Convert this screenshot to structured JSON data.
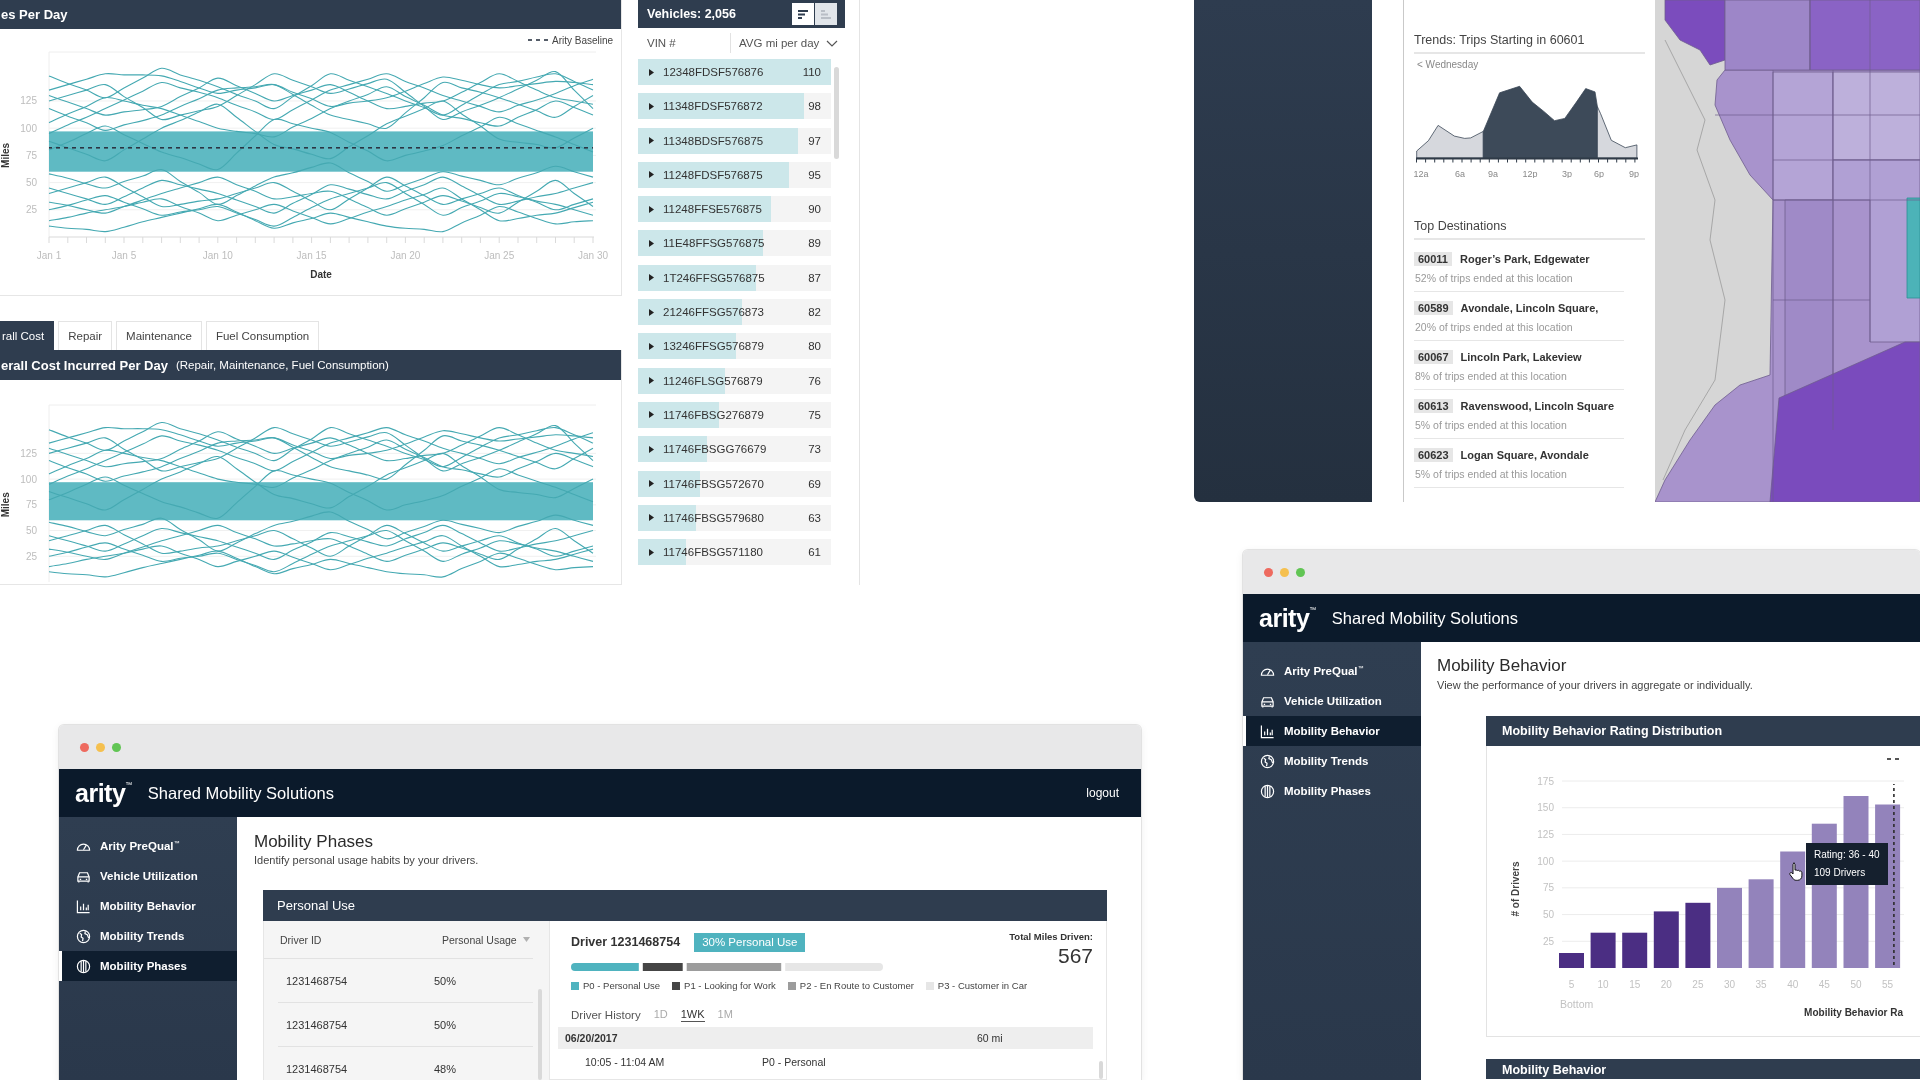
{
  "daily_miles": {
    "title": "es Per Day",
    "chart_data": {
      "type": "line",
      "xlabel": "Date",
      "ylabel": "Miles",
      "categories": [
        "Jan 1",
        null,
        null,
        null,
        "Jan 5",
        null,
        null,
        null,
        null,
        "Jan 10",
        null,
        null,
        null,
        null,
        "Jan 15",
        null,
        null,
        null,
        null,
        "Jan 20",
        null,
        null,
        null,
        null,
        "Jan 25",
        null,
        null,
        null,
        null,
        "Jan 30"
      ],
      "series": [
        {
          "color": "#45a9b2",
          "values": [
            135,
            140,
            145,
            150,
            149,
            149,
            148,
            143,
            137,
            132,
            135,
            137,
            140,
            133,
            127,
            120,
            123,
            125,
            128,
            134,
            141,
            147,
            144,
            140,
            137,
            139,
            141,
            143,
            142,
            140
          ]
        },
        {
          "color": "#45a9b2",
          "values": [
            130,
            124,
            118,
            112,
            115,
            117,
            120,
            129,
            137,
            146,
            139,
            132,
            125,
            130,
            135,
            140,
            133,
            125,
            118,
            120,
            123,
            125,
            133,
            142,
            150,
            143,
            135,
            128,
            125,
            122
          ]
        },
        {
          "color": "#45a9b2",
          "values": [
            125,
            130,
            135,
            140,
            129,
            119,
            108,
            112,
            116,
            120,
            130,
            140,
            150,
            144,
            138,
            132,
            136,
            141,
            145,
            133,
            120,
            108,
            115,
            121,
            128,
            136,
            144,
            152,
            135,
            118
          ]
        },
        {
          "color": "#45a9b2",
          "values": [
            95,
            103,
            110,
            118,
            126,
            134,
            142,
            137,
            133,
            128,
            121,
            115,
            108,
            117,
            126,
            135,
            140,
            145,
            150,
            143,
            137,
            130,
            125,
            120,
            115,
            121,
            126,
            132,
            139,
            145
          ]
        },
        {
          "color": "#45a9b2",
          "values": [
            118,
            111,
            105,
            98,
            103,
            107,
            112,
            120,
            127,
            135,
            137,
            138,
            140,
            131,
            121,
            112,
            108,
            104,
            100,
            114,
            128,
            142,
            137,
            133,
            128,
            122,
            116,
            110,
            120,
            130
          ]
        },
        {
          "color": "#45a9b2",
          "values": [
            105,
            113,
            120,
            128,
            125,
            121,
            118,
            112,
            106,
            100,
            97,
            95,
            92,
            101,
            109,
            118,
            125,
            131,
            138,
            129,
            121,
            112,
            109,
            105,
            102,
            110,
            117,
            125,
            119,
            112
          ]
        },
        {
          "color": "#45a9b2",
          "values": [
            88,
            82,
            76,
            70,
            80,
            90,
            100,
            107,
            115,
            122,
            110,
            97,
            85,
            81,
            76,
            72,
            83,
            93,
            104,
            111,
            118,
            125,
            113,
            102,
            90,
            87,
            85,
            82,
            91,
            100
          ]
        },
        {
          "color": "#45a9b2",
          "values": [
            80,
            87,
            95,
            102,
            94,
            86,
            78,
            73,
            67,
            62,
            77,
            93,
            108,
            104,
            100,
            96,
            87,
            79,
            70,
            75,
            79,
            84,
            93,
            101,
            110,
            104,
            98,
            92,
            85,
            78
          ]
        },
        {
          "color": "#45a9b2",
          "values": [
            45,
            40,
            35,
            30,
            37,
            45,
            52,
            48,
            44,
            40,
            34,
            28,
            22,
            31,
            39,
            48,
            44,
            39,
            35,
            42,
            48,
            55,
            47,
            38,
            30,
            33,
            37,
            40,
            45,
            50
          ]
        },
        {
          "color": "#45a9b2",
          "values": [
            40,
            45,
            50,
            55,
            46,
            37,
            28,
            30,
            33,
            35,
            40,
            45,
            50,
            42,
            33,
            25,
            35,
            45,
            55,
            47,
            38,
            30,
            35,
            40,
            45,
            38,
            32,
            25,
            30,
            35
          ]
        },
        {
          "color": "#45a9b2",
          "values": [
            32,
            29,
            25,
            22,
            28,
            34,
            40,
            45,
            50,
            55,
            48,
            42,
            35,
            37,
            40,
            42,
            35,
            27,
            20,
            26,
            32,
            38,
            33,
            27,
            22,
            32,
            42,
            52,
            40,
            28
          ]
        },
        {
          "color": "#45a9b2",
          "values": [
            25,
            29,
            34,
            38,
            32,
            26,
            20,
            23,
            25,
            28,
            22,
            16,
            10,
            18,
            27,
            35,
            40,
            45,
            50,
            40,
            30,
            20,
            27,
            33,
            40,
            37,
            33,
            30,
            25,
            20
          ]
        },
        {
          "color": "#45a9b2",
          "values": [
            15,
            18,
            22,
            25,
            28,
            32,
            35,
            28,
            22,
            15,
            20,
            25,
            30,
            24,
            18,
            12,
            17,
            23,
            28,
            34,
            39,
            45,
            35,
            25,
            15,
            17,
            20,
            22,
            27,
            32
          ]
        },
        {
          "color": "#45a9b2",
          "values": [
            10,
            8,
            7,
            5,
            9,
            14,
            18,
            22,
            26,
            30,
            23,
            15,
            8,
            13,
            17,
            22,
            18,
            14,
            10,
            8,
            7,
            5,
            13,
            20,
            28,
            23,
            17,
            12,
            14,
            15
          ]
        },
        {
          "color": "#45a9b2",
          "values": [
            58,
            54,
            49,
            45,
            51,
            56,
            62,
            51,
            41,
            30,
            38,
            47,
            55,
            59,
            64,
            68,
            59,
            51,
            42,
            48,
            54,
            60,
            56,
            52,
            48,
            54,
            59,
            65,
            60,
            55
          ]
        },
        {
          "color": "#45a9b2",
          "values": [
            148,
            141,
            135,
            128,
            137,
            146,
            155,
            149,
            144,
            138,
            131,
            125,
            118,
            129,
            139,
            150,
            144,
            138,
            132,
            125,
            119,
            112,
            121,
            131,
            140,
            143,
            147,
            150,
            143,
            135
          ]
        }
      ],
      "ylim": [
        0,
        170
      ],
      "yticks": [
        25,
        50,
        75,
        100,
        125
      ],
      "grid": true,
      "bands": [
        {
          "axis": "y",
          "from": 60,
          "to": 97,
          "color": "#5fbac3"
        }
      ],
      "ref_lines": [
        {
          "axis": "y",
          "value": 82,
          "label": "Arity Baseline"
        }
      ]
    }
  },
  "cost_tabs": [
    {
      "label": "rall Cost",
      "selected": true
    },
    {
      "label": "Repair",
      "selected": false
    },
    {
      "label": "Maintenance",
      "selected": false
    },
    {
      "label": "Fuel Consumption",
      "selected": false
    }
  ],
  "daily_cost": {
    "title": "erall Cost Incurred Per Day",
    "subtitle": "(Repair, Maintenance, Fuel Consumption)",
    "chart_data": {
      "type": "line",
      "ylabel": "Miles",
      "categories": [
        null,
        null,
        null,
        null,
        null,
        null,
        null,
        null,
        null,
        null,
        null,
        null,
        null,
        null,
        null,
        null,
        null,
        null,
        null,
        null,
        null,
        null,
        null,
        null,
        null,
        null,
        null,
        null,
        null,
        null
      ],
      "series": [
        {
          "color": "#45a9b2",
          "values": [
            135,
            140,
            145,
            150,
            149,
            149,
            148,
            143,
            137,
            132,
            135,
            137,
            140,
            133,
            127,
            120,
            123,
            125,
            128,
            134,
            141,
            147,
            144,
            140,
            137,
            139,
            141,
            143,
            142,
            140
          ]
        },
        {
          "color": "#45a9b2",
          "values": [
            130,
            124,
            118,
            112,
            115,
            117,
            120,
            129,
            137,
            146,
            139,
            132,
            125,
            130,
            135,
            140,
            133,
            125,
            118,
            120,
            123,
            125,
            133,
            142,
            150,
            143,
            135,
            128,
            125,
            122
          ]
        },
        {
          "color": "#45a9b2",
          "values": [
            125,
            130,
            135,
            140,
            129,
            119,
            108,
            112,
            116,
            120,
            130,
            140,
            150,
            144,
            138,
            132,
            136,
            141,
            145,
            133,
            120,
            108,
            115,
            121,
            128,
            136,
            144,
            152,
            135,
            118
          ]
        },
        {
          "color": "#45a9b2",
          "values": [
            95,
            103,
            110,
            118,
            126,
            134,
            142,
            137,
            133,
            128,
            121,
            115,
            108,
            117,
            126,
            135,
            140,
            145,
            150,
            143,
            137,
            130,
            125,
            120,
            115,
            121,
            126,
            132,
            139,
            145
          ]
        },
        {
          "color": "#45a9b2",
          "values": [
            118,
            111,
            105,
            98,
            103,
            107,
            112,
            120,
            127,
            135,
            137,
            138,
            140,
            131,
            121,
            112,
            108,
            104,
            100,
            114,
            128,
            142,
            137,
            133,
            128,
            122,
            116,
            110,
            120,
            130
          ]
        },
        {
          "color": "#45a9b2",
          "values": [
            105,
            113,
            120,
            128,
            125,
            121,
            118,
            112,
            106,
            100,
            97,
            95,
            92,
            101,
            109,
            118,
            125,
            131,
            138,
            129,
            121,
            112,
            109,
            105,
            102,
            110,
            117,
            125,
            119,
            112
          ]
        },
        {
          "color": "#45a9b2",
          "values": [
            88,
            82,
            76,
            70,
            80,
            90,
            100,
            107,
            115,
            122,
            110,
            97,
            85,
            81,
            76,
            72,
            83,
            93,
            104,
            111,
            118,
            125,
            113,
            102,
            90,
            87,
            85,
            82,
            91,
            100
          ]
        },
        {
          "color": "#45a9b2",
          "values": [
            80,
            87,
            95,
            102,
            94,
            86,
            78,
            73,
            67,
            62,
            77,
            93,
            108,
            104,
            100,
            96,
            87,
            79,
            70,
            75,
            79,
            84,
            93,
            101,
            110,
            104,
            98,
            92,
            85,
            78
          ]
        },
        {
          "color": "#45a9b2",
          "values": [
            45,
            40,
            35,
            30,
            37,
            45,
            52,
            48,
            44,
            40,
            34,
            28,
            22,
            31,
            39,
            48,
            44,
            39,
            35,
            42,
            48,
            55,
            47,
            38,
            30,
            33,
            37,
            40,
            45,
            50
          ]
        },
        {
          "color": "#45a9b2",
          "values": [
            40,
            45,
            50,
            55,
            46,
            37,
            28,
            30,
            33,
            35,
            40,
            45,
            50,
            42,
            33,
            25,
            35,
            45,
            55,
            47,
            38,
            30,
            35,
            40,
            45,
            38,
            32,
            25,
            30,
            35
          ]
        },
        {
          "color": "#45a9b2",
          "values": [
            32,
            29,
            25,
            22,
            28,
            34,
            40,
            45,
            50,
            55,
            48,
            42,
            35,
            37,
            40,
            42,
            35,
            27,
            20,
            26,
            32,
            38,
            33,
            27,
            22,
            32,
            42,
            52,
            40,
            28
          ]
        },
        {
          "color": "#45a9b2",
          "values": [
            25,
            29,
            34,
            38,
            32,
            26,
            20,
            23,
            25,
            28,
            22,
            16,
            10,
            18,
            27,
            35,
            40,
            45,
            50,
            40,
            30,
            20,
            27,
            33,
            40,
            37,
            33,
            30,
            25,
            20
          ]
        },
        {
          "color": "#45a9b2",
          "values": [
            15,
            18,
            22,
            25,
            28,
            32,
            35,
            28,
            22,
            15,
            20,
            25,
            30,
            24,
            18,
            12,
            17,
            23,
            28,
            34,
            39,
            45,
            35,
            25,
            15,
            17,
            20,
            22,
            27,
            32
          ]
        },
        {
          "color": "#45a9b2",
          "values": [
            10,
            8,
            7,
            5,
            9,
            14,
            18,
            22,
            26,
            30,
            23,
            15,
            8,
            13,
            17,
            22,
            18,
            14,
            10,
            8,
            7,
            5,
            13,
            20,
            28,
            23,
            17,
            12,
            14,
            15
          ]
        },
        {
          "color": "#45a9b2",
          "values": [
            58,
            54,
            49,
            45,
            51,
            56,
            62,
            51,
            41,
            30,
            38,
            47,
            55,
            59,
            64,
            68,
            59,
            51,
            42,
            48,
            54,
            60,
            56,
            52,
            48,
            54,
            59,
            65,
            60,
            55
          ]
        },
        {
          "color": "#45a9b2",
          "values": [
            148,
            141,
            135,
            128,
            137,
            146,
            155,
            149,
            144,
            138,
            131,
            125,
            118,
            129,
            139,
            150,
            144,
            138,
            132,
            125,
            119,
            112,
            121,
            131,
            140,
            143,
            147,
            150,
            143,
            135
          ]
        }
      ],
      "ylim": [
        0,
        172
      ],
      "yticks": [
        25,
        50,
        75,
        100,
        125
      ],
      "grid": true,
      "bands": [
        {
          "axis": "y",
          "from": 60,
          "to": 97,
          "color": "#5fbac3"
        }
      ]
    }
  },
  "vehicles": {
    "title": "Vehicles: 2,056",
    "sort_toggles": [
      {
        "kind": "descending",
        "selected": true
      },
      {
        "kind": "ascending",
        "selected": false
      }
    ],
    "columns": [
      "VIN #",
      "AVG mi per day"
    ],
    "rows": [
      {
        "vin": "12348FDSF576876",
        "value": "110",
        "level": 1.0
      },
      {
        "vin": "11348FDSF576872",
        "value": "98",
        "level": 0.86
      },
      {
        "vin": "11348BDSF576875",
        "value": "97",
        "level": 0.83
      },
      {
        "vin": "11248FDSF576875",
        "value": "95",
        "level": 0.78
      },
      {
        "vin": "11248FFSE576875",
        "value": "90",
        "level": 0.69
      },
      {
        "vin": "11E48FFSG576875",
        "value": "89",
        "level": 0.65
      },
      {
        "vin": "1T246FFSG576875",
        "value": "87",
        "level": 0.61
      },
      {
        "vin": "21246FFSG576873",
        "value": "82",
        "level": 0.54
      },
      {
        "vin": "13246FFSG576879",
        "value": "80",
        "level": 0.51
      },
      {
        "vin": "11246FLSG576879",
        "value": "76",
        "level": 0.45
      },
      {
        "vin": "11746FBSG276879",
        "value": "75",
        "level": 0.42
      },
      {
        "vin": "11746FBSGG76679",
        "value": "73",
        "level": 0.36
      },
      {
        "vin": "11746FBSG572670",
        "value": "69",
        "level": 0.32
      },
      {
        "vin": "11746FBSG579680",
        "value": "63",
        "level": 0.3
      },
      {
        "vin": "11746FBSG571180",
        "value": "61",
        "level": 0.25
      }
    ]
  },
  "trips": {
    "title": "Trends: Trips Starting in 60601",
    "back_link": "< Wednesday",
    "hours": [
      "12a",
      "6a",
      "9a",
      "12p",
      "3p",
      "6p",
      "9p"
    ]
  },
  "destinations": {
    "title": "Top Destinations",
    "items": [
      {
        "zip": "60011",
        "name": "Roger’s Park, Edgewater",
        "share": "52% of trips ended at this location"
      },
      {
        "zip": "60589",
        "name": "Avondale, Lincoln Square,",
        "share": "20% of trips ended at this location"
      },
      {
        "zip": "60067",
        "name": "Lincoln Park, Lakeview",
        "share": "8% of trips ended at this location"
      },
      {
        "zip": "60613",
        "name": "Ravenswood, Lincoln Square",
        "share": "5% of trips ended at this location"
      },
      {
        "zip": "60623",
        "name": "Logan Square, Avondale",
        "share": "5% of trips ended at this location"
      }
    ]
  },
  "windows": [
    {
      "kind": "phases",
      "logo": "arity$^{™}$",
      "app_title": "Shared Mobility Solutions",
      "logout": "logout",
      "sidebar": [
        {
          "label": "Arity PreQual$^{™}$",
          "kind": "gauge",
          "selected": false
        },
        {
          "label": "Vehicle Utilization",
          "kind": "car",
          "selected": false
        },
        {
          "label": "Mobility Behavior",
          "kind": "chart",
          "selected": false
        },
        {
          "label": "Mobility Trends",
          "kind": "globe",
          "selected": false
        },
        {
          "label": "Mobility Phases",
          "kind": "phases",
          "selected": true
        }
      ],
      "page_title": "Mobility Phases",
      "page_subtitle": "Identify personal usage habits by your drivers.",
      "panel": {
        "title": "Personal Use",
        "columns": [
          "Driver ID",
          "Personal Usage"
        ],
        "rows": [
          {
            "driver_id": "1231468754",
            "usage": "50%"
          },
          {
            "driver_id": "1231468754",
            "usage": "50%"
          },
          {
            "driver_id": "1231468754",
            "usage": "48%"
          }
        ],
        "driver": "Driver 1231468754",
        "badge": "30% Personal Use",
        "total_label": "Total Miles Driven:",
        "total": "567",
        "legend": [
          {
            "label": "P0 - Personal Use",
            "color": "#4fb3bf"
          },
          {
            "label": "P1 - Looking for Work",
            "color": "#454545"
          },
          {
            "label": "P2 - En Route to Customer",
            "color": "#9c9c9c"
          },
          {
            "label": "P3 - Customer in Car",
            "color": "#e6e6e6"
          }
        ],
        "history_label": "Driver History",
        "ranges": [
          {
            "label": "1D",
            "selected": false
          },
          {
            "label": "1WK",
            "selected": true
          },
          {
            "label": "1M",
            "selected": false
          }
        ],
        "day": {
          "date": "06/20/2017",
          "distance": "60 mi"
        },
        "trips": [
          {
            "time": "10:05 - 11:04 AM",
            "phase": "P0 - Personal"
          }
        ]
      }
    },
    {
      "kind": "behavior",
      "logo": "arity$^{™}$",
      "app_title": "Shared Mobility Solutions",
      "sidebar": [
        {
          "label": "Arity PreQual$^{™}$",
          "kind": "gauge",
          "selected": false
        },
        {
          "label": "Vehicle Utilization",
          "kind": "car",
          "selected": false
        },
        {
          "label": "Mobility Behavior",
          "kind": "chart",
          "selected": true
        },
        {
          "label": "Mobility Trends",
          "kind": "globe",
          "selected": false
        },
        {
          "label": "Mobility Phases",
          "kind": "phases",
          "selected": false
        }
      ],
      "page_title": "Mobility Behavior",
      "page_subtitle": "View the performance of your drivers in aggregate or individually.",
      "panel": {
        "title": "Mobility Behavior Rating Distribution",
        "range_label": "Bottom",
        "tooltip": {
          "title": "Rating: 36 - 40",
          "value": "109 Drivers"
        },
        "chart_data": {
          "type": "bar",
          "xlabel": "Mobility Behavior Ra",
          "ylabel": "# of Drivers",
          "x": [
            5,
            10,
            15,
            20,
            25,
            30,
            35,
            40,
            45,
            50,
            55
          ],
          "series": [
            {
              "color": "#4b2e83",
              "values": [
                14,
                33,
                33,
                53,
                61,
                null,
                null,
                null,
                null,
                null,
                null
              ]
            },
            {
              "color": "#9383bb",
              "values": [
                null,
                null,
                null,
                null,
                null,
                75,
                83,
                109,
                135,
                161,
                153
              ]
            }
          ],
          "xlim": [
            3.5,
            57.6
          ],
          "ylim": [
            0,
            175
          ],
          "xticks": [
            5,
            10,
            15,
            20,
            25,
            30,
            35,
            40,
            45,
            50,
            55
          ],
          "yticks": [
            25,
            50,
            75,
            100,
            125,
            150,
            175
          ],
          "grid": true,
          "stacked": true,
          "ref_lines": [
            {
              "axis": "x",
              "value": 56
            }
          ]
        }
      },
      "next_panel": {
        "title": "Mobility Behavior"
      }
    }
  ]
}
